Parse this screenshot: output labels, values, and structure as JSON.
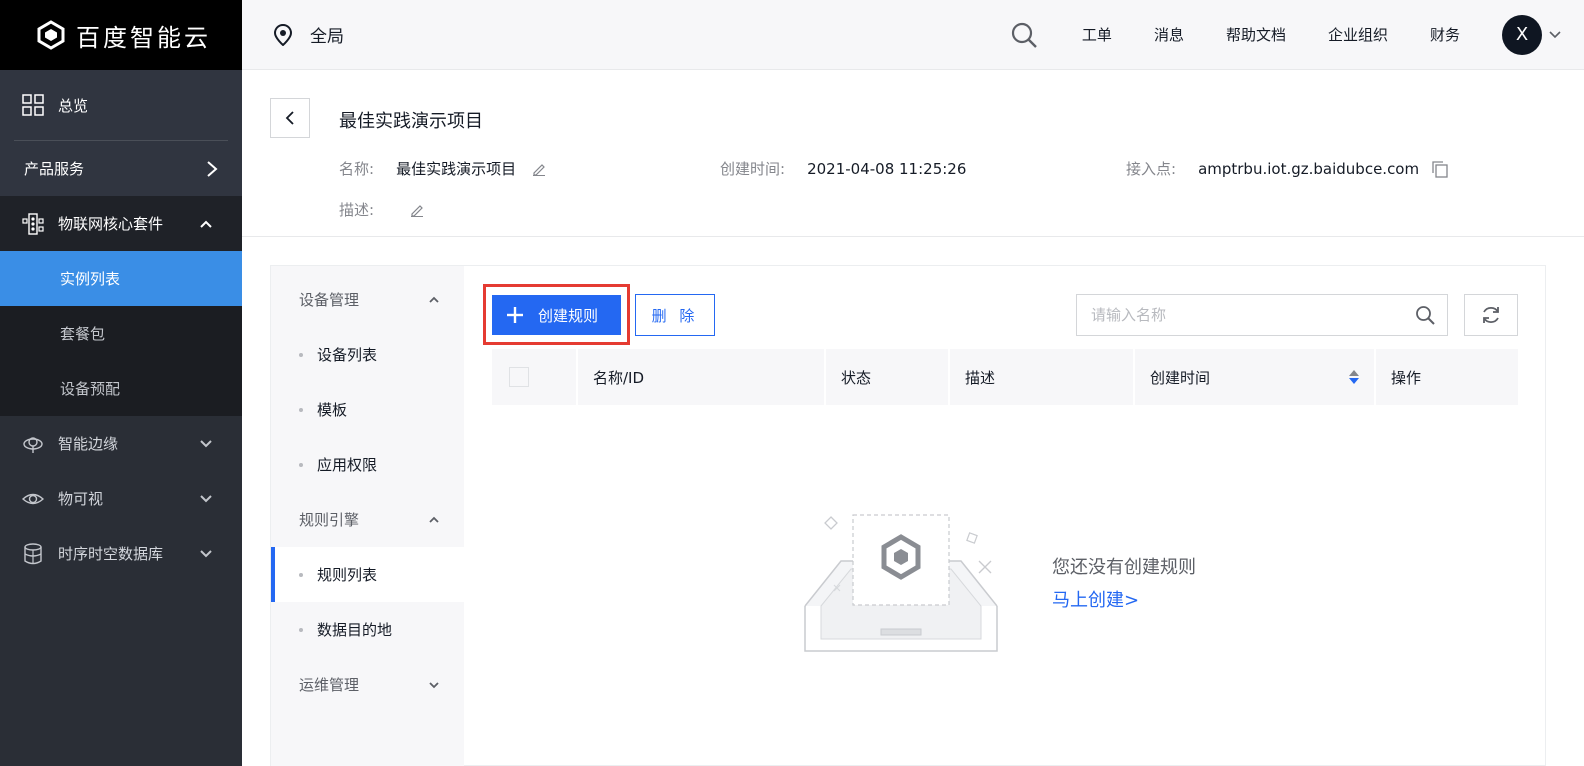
{
  "brand": {
    "name": "百度智能云"
  },
  "sidebar": {
    "overview": "总览",
    "product_services": "产品服务",
    "groups": [
      {
        "label": "物联网核心套件",
        "icon": "iot-core-icon",
        "open": true,
        "items": [
          {
            "label": "实例列表",
            "active": true
          },
          {
            "label": "套餐包"
          },
          {
            "label": "设备预配"
          }
        ]
      },
      {
        "label": "智能边缘",
        "icon": "edge-icon"
      },
      {
        "label": "物可视",
        "icon": "eye-icon"
      },
      {
        "label": "时序时空数据库",
        "icon": "database-icon"
      }
    ]
  },
  "header": {
    "region": "全局",
    "links": [
      "工单",
      "消息",
      "帮助文档",
      "企业组织",
      "财务"
    ],
    "avatar_letter": "X"
  },
  "project": {
    "title": "最佳实践演示项目",
    "name_label": "名称:",
    "name_value": "最佳实践演示项目",
    "created_label": "创建时间:",
    "created_value": "2021-04-08 11:25:26",
    "endpoint_label": "接入点:",
    "endpoint_value": "amptrbu.iot.gz.baidubce.com",
    "desc_label": "描述:"
  },
  "subnav": {
    "device_mgmt": "设备管理",
    "device_items": [
      "设备列表",
      "模板",
      "应用权限"
    ],
    "rule_engine": "规则引擎",
    "rule_items": [
      "规则列表",
      "数据目的地"
    ],
    "ops_mgmt": "运维管理"
  },
  "toolbar": {
    "create_label": "创建规则",
    "delete_label": "删 除",
    "search_placeholder": "请输入名称"
  },
  "table": {
    "columns": [
      "名称/ID",
      "状态",
      "描述",
      "创建时间",
      "操作"
    ]
  },
  "empty": {
    "message": "您还没有创建规则",
    "link": "马上创建>"
  },
  "colors": {
    "primary": "#2468f2",
    "sidebar_bg": "#2a2e36",
    "active_nav": "#3a8ee6",
    "highlight": "#e53b32"
  }
}
